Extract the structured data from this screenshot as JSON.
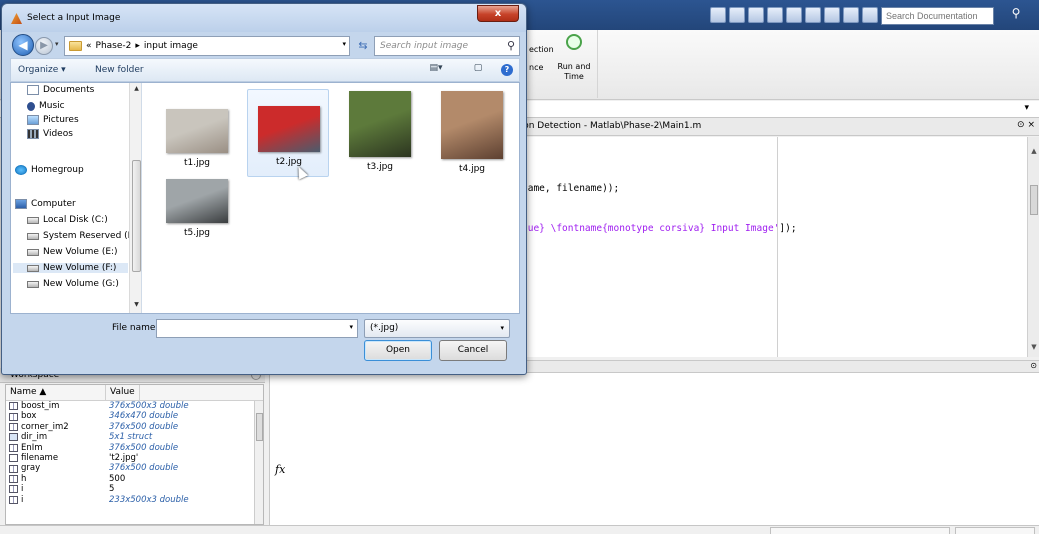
{
  "matlab": {
    "search_placeholder": "Search Documentation",
    "ribbon": {
      "section_label": "ection",
      "section_label2": "nce",
      "run_and_time": "Run and\nTime"
    },
    "editor": {
      "title": "gion Detection - Matlab\\Phase-2\\Main1.m",
      "lines": [
        {
          "pre": "name, filename));",
          "str": "",
          "post": ""
        },
        {
          "pre": "",
          "str": "lue} \\fontname{monotype corsiva} Input Image'",
          "post": "]);"
        }
      ]
    },
    "workspace": {
      "title": "Workspace",
      "col_name": "Name ▲",
      "col_value": "Value",
      "rows": [
        {
          "name": "boost_im",
          "value": "376x500x3 double",
          "italic": true,
          "icon": "grid"
        },
        {
          "name": "box",
          "value": "346x470 double",
          "italic": true,
          "icon": "grid"
        },
        {
          "name": "corner_im2",
          "value": "376x500 double",
          "italic": true,
          "icon": "grid"
        },
        {
          "name": "dir_im",
          "value": "5x1 struct",
          "italic": true,
          "icon": "struct"
        },
        {
          "name": "EnIm",
          "value": "376x500 double",
          "italic": true,
          "icon": "grid"
        },
        {
          "name": "filename",
          "value": "'t2.jpg'",
          "italic": false,
          "icon": "char"
        },
        {
          "name": "gray",
          "value": "376x500 double",
          "italic": true,
          "icon": "grid"
        },
        {
          "name": "h",
          "value": "500",
          "italic": false,
          "icon": "grid"
        },
        {
          "name": "i",
          "value": "5",
          "italic": false,
          "icon": "grid"
        },
        {
          "name": "i",
          "value": "233x500x3 double",
          "italic": true,
          "icon": "grid"
        }
      ]
    },
    "command_prompt": "fx"
  },
  "dialog": {
    "title": "Select a Input Image",
    "close_label": "x",
    "breadcrumb": {
      "prefix": "«",
      "parts": [
        "Phase-2",
        "input image"
      ],
      "separator": "▸"
    },
    "search_placeholder": "Search input image",
    "toolbar": {
      "organize": "Organize ▾",
      "new_folder": "New folder"
    },
    "nav_items": [
      {
        "label": "Documents",
        "icon": "docs"
      },
      {
        "label": "Music",
        "icon": "music"
      },
      {
        "label": "Pictures",
        "icon": "pics"
      },
      {
        "label": "Videos",
        "icon": "vids"
      },
      {
        "label": "Homegroup",
        "icon": "home"
      },
      {
        "label": "Computer",
        "icon": "pc"
      },
      {
        "label": "Local Disk (C:)",
        "icon": "disk"
      },
      {
        "label": "System Reserved (D",
        "icon": "disk"
      },
      {
        "label": "New Volume (E:)",
        "icon": "disk"
      },
      {
        "label": "New Volume (F:)",
        "icon": "disk",
        "selected": true
      },
      {
        "label": "New Volume (G:)",
        "icon": "disk"
      }
    ],
    "files": [
      {
        "name": "t1.jpg",
        "colors": [
          "#c9c5bd",
          "#9a8f84"
        ]
      },
      {
        "name": "t2.jpg",
        "colors": [
          "#cc2b2b",
          "#4b5c6d"
        ],
        "hover": true
      },
      {
        "name": "t3.jpg",
        "colors": [
          "#5d7a3b",
          "#2c3520"
        ]
      },
      {
        "name": "t4.jpg",
        "colors": [
          "#b38a6a",
          "#5d4031"
        ]
      },
      {
        "name": "t5.jpg",
        "colors": [
          "#9fa5a8",
          "#3a3d3f"
        ]
      }
    ],
    "file_name_label": "File name:",
    "file_name_value": "",
    "file_type": "(*.jpg)",
    "open_label": "Open",
    "cancel_label": "Cancel"
  }
}
